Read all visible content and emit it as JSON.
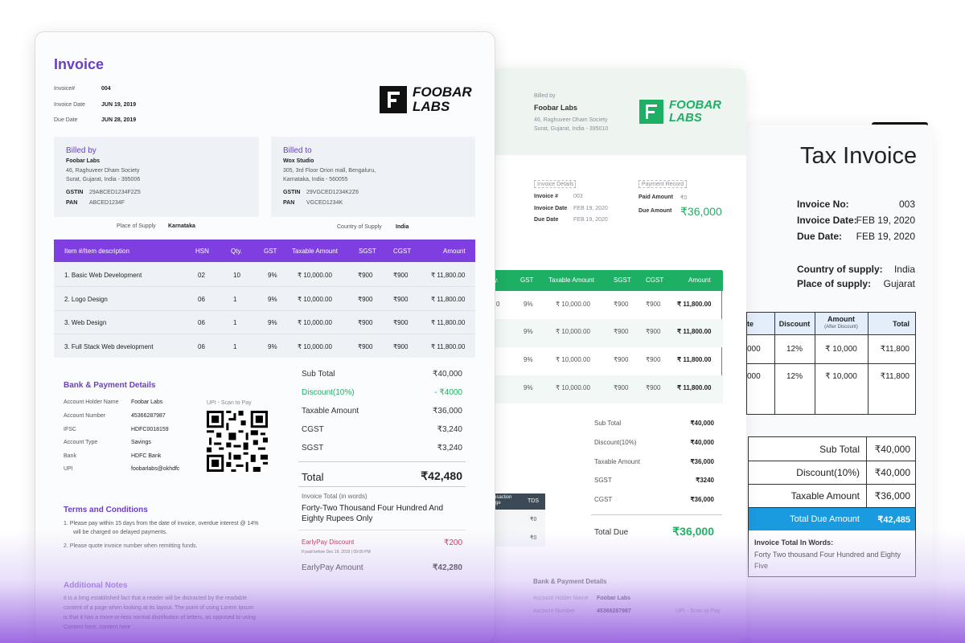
{
  "invoice1": {
    "title": "Invoice",
    "meta": [
      {
        "label": "Invoice#",
        "value": "004"
      },
      {
        "label": "Invoice Date",
        "value": "JUN 19, 2019"
      },
      {
        "label": "Due Date",
        "value": "JUN 28, 2019"
      }
    ],
    "logo": {
      "line1": "FOOBAR",
      "line2": "LABS"
    },
    "billed_by": {
      "heading": "Billed by",
      "name": "Foobar Labs",
      "address1": "46, Raghuveer Dham Society",
      "address2": "Surat, Gujarat, India - 395006",
      "gstin_label": "GSTIN",
      "gstin": "29ABCED1234F2Z5",
      "pan_label": "PAN",
      "pan": "ABCED1234F"
    },
    "billed_to": {
      "heading": "Billed to",
      "name": "Wox Studio",
      "address1": "305, 3rd Floor Orion mall, Bengaluru,",
      "address2": "Karnataka, India - 560055",
      "gstin_label": "GSTIN",
      "gstin": "29VGCED1234K2Z6",
      "pan_label": "PAN",
      "pan": "VGCED1234K"
    },
    "place_of_supply_label": "Place of Supply",
    "place_of_supply": "Karnataka",
    "country_of_supply_label": "Country of Supply",
    "country_of_supply": "India",
    "table_headers": [
      "Item #/Item description",
      "HSN",
      "Qty.",
      "GST",
      "Taxable Amount",
      "SGST",
      "CGST",
      "Amount"
    ],
    "rows": [
      [
        "1.  Basic Web Development",
        "02",
        "10",
        "9%",
        "₹ 10,000.00",
        "₹900",
        "₹900",
        "₹ 11,800.00"
      ],
      [
        "2.  Logo Design",
        "06",
        "1",
        "9%",
        "₹ 10,000.00",
        "₹900",
        "₹900",
        "₹ 11,800.00"
      ],
      [
        "3.  Web Design",
        "06",
        "1",
        "9%",
        "₹ 10,000.00",
        "₹900",
        "₹900",
        "₹ 11,800.00"
      ],
      [
        "3.  Full Stack Web development",
        "06",
        "1",
        "9%",
        "₹ 10,000.00",
        "₹900",
        "₹900",
        "₹ 11,800.00"
      ]
    ],
    "bank": {
      "heading": "Bank & Payment Details",
      "items": [
        {
          "label": "Account Holder Name",
          "value": "Foobar Labs"
        },
        {
          "label": "Account Number",
          "value": "45366287987"
        },
        {
          "label": "IFSC",
          "value": "HDFC0018159"
        },
        {
          "label": "Account Type",
          "value": "Savings"
        },
        {
          "label": "Bank",
          "value": "HDFC Bank"
        },
        {
          "label": "UPI",
          "value": "foobarlabs@okhdfc"
        }
      ],
      "upi_caption": "UPI - Scan to Pay"
    },
    "summary": {
      "subtotal_label": "Sub Total",
      "subtotal": "₹40,000",
      "discount_label": "Discount(10%)",
      "discount": "- ₹4000",
      "taxable_label": "Taxable Amount",
      "taxable": "₹36,000",
      "cgst_label": "CGST",
      "cgst": "₹3,240",
      "sgst_label": "SGST",
      "sgst": "₹3,240",
      "total_label": "Total",
      "total": "₹42,480",
      "words_label": "Invoice Total (in words)",
      "words_line1": "Forty-Two Thousand Four Hundred And",
      "words_line2": "Eighty Rupees Only",
      "early_label": "EarlyPay Discount",
      "early": "₹200",
      "early_note": "If paid before Dec 19, 2019 | 09:00 PM",
      "early_amount_label": "EarlyPay Amount",
      "early_amount": "₹42,280"
    },
    "terms": {
      "heading": "Terms and Conditions",
      "items": [
        "1.  Please pay within 15 days from the date of invoice, overdue interest @ 14%",
        "will be charged on delayed payments.",
        "2.  Please quote invoice number when remitting funds."
      ]
    },
    "notes": {
      "heading": "Additional Notes",
      "lines": [
        "It is a long established fact that a reader will be distracted by the readable",
        "content of a page when looking at its layout. The point of using Lorem Ipsum",
        "is that it has a more-or-less normal distribution of letters, as opposed to using",
        "Content here, content here"
      ]
    }
  },
  "invoice2": {
    "billed_by_label": "Billed by",
    "name": "Foobar Labs",
    "address1": "46, Raghuveer Dham Society",
    "address2": "Surat, Gujarat, India - 395010",
    "logo": {
      "line1": "FOOBAR",
      "line2": "LABS"
    },
    "details_heading": "Invoice Details",
    "details": [
      {
        "label": "Invoice #",
        "value": "003"
      },
      {
        "label": "Invoice Date",
        "value": "FEB 19, 2020"
      },
      {
        "label": "Due Date",
        "value": "FEB 19, 2020"
      }
    ],
    "payment_heading": "Payment Record",
    "paid_label": "Paid Amount",
    "paid": "₹0",
    "due_label": "Due Amount",
    "due": "₹36,000",
    "table_headers": [
      "ty.",
      "GST",
      "Taxable Amount",
      "SGST",
      "CGST",
      "Amount"
    ],
    "rows": [
      [
        "0",
        "9%",
        "₹ 10,000.00",
        "₹900",
        "₹900",
        "₹ 11,800.00"
      ],
      [
        "",
        "9%",
        "₹ 10,000.00",
        "₹900",
        "₹900",
        "₹ 11,800.00"
      ],
      [
        "",
        "9%",
        "₹ 10,000.00",
        "₹900",
        "₹900",
        "₹ 11,800.00"
      ],
      [
        "",
        "9%",
        "₹ 10,000.00",
        "₹900",
        "₹900",
        "₹ 11,800.00"
      ]
    ],
    "summary": [
      {
        "label": "Sub Total",
        "value": "₹40,000"
      },
      {
        "label": "Discount(10%)",
        "value": "₹40,000"
      },
      {
        "label": "Taxable Amount",
        "value": "₹36,000"
      },
      {
        "label": "SGST",
        "value": "₹3240"
      },
      {
        "label": "CGST",
        "value": "₹36,000"
      }
    ],
    "total_due_label": "Total Due",
    "total_due": "₹36,000",
    "tx_headers": [
      "nsaction\nrge",
      "TDS"
    ],
    "tx_rows": [
      [
        "",
        "₹0"
      ],
      [
        "",
        "₹0"
      ]
    ],
    "bank_heading": "Bank & Payment Details",
    "bank_items": [
      {
        "label": "Account Holder Name",
        "value": "Foobar Labs"
      },
      {
        "label": "Account Number",
        "value": "45366287987"
      }
    ],
    "upi_caption": "UPI - Scan to Pay"
  },
  "invoice3": {
    "title": "Tax Invoice",
    "meta": [
      {
        "label": "Invoice No:",
        "value": "003"
      },
      {
        "label": "Invoice Date:",
        "value": "FEB 19, 2020"
      },
      {
        "label": "Due Date:",
        "value": "FEB 19, 2020"
      }
    ],
    "country_label": "Country of supply:",
    "country": "India",
    "place_label": "Place of supply:",
    "place": "Gujarat",
    "table_headers": [
      "te",
      "Discount",
      "Amount",
      "(After Discount)",
      "Total"
    ],
    "rows": [
      [
        "000",
        "12%",
        "₹ 10,000",
        "₹11,800"
      ],
      [
        "000",
        "12%",
        "₹ 10,000",
        "₹11,800"
      ]
    ],
    "summary": [
      {
        "label": "Sub Total",
        "value": "₹40,000"
      },
      {
        "label": "Discount(10%)",
        "value": "₹40,000"
      },
      {
        "label": "Taxable Amount",
        "value": "₹36,000"
      }
    ],
    "total_due_label": "Total Due Amount",
    "total_due": "₹42,485",
    "words_label": "Invoice Total In Words:",
    "words_line1": "Forty Two thousand Four Hundred and Eighty",
    "words_line2": "Five"
  },
  "colors": {
    "purple": "#6b3fc4",
    "green": "#1db064",
    "blue": "#1a9be0"
  }
}
